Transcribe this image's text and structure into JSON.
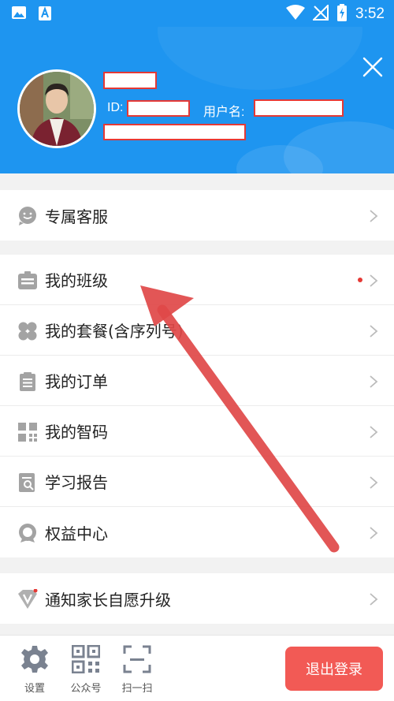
{
  "status_bar": {
    "time": "3:52"
  },
  "profile": {
    "id_label": "ID:",
    "username_label": "用户名:"
  },
  "menu": {
    "service": {
      "label": "专属客服"
    },
    "items": [
      {
        "label": "我的班级",
        "has_dot": true
      },
      {
        "label": "我的套餐(含序列号)"
      },
      {
        "label": "我的订单"
      },
      {
        "label": "我的智码"
      },
      {
        "label": "学习报告"
      },
      {
        "label": "权益中心"
      }
    ],
    "upgrade": {
      "label": "通知家长自愿升级"
    }
  },
  "bottom_bar": {
    "settings": "设置",
    "official_account": "公众号",
    "scan": "扫一扫",
    "logout": "退出登录"
  },
  "colors": {
    "primary": "#1E95F0",
    "logout": "#F25A55",
    "annotation": "#E04848"
  }
}
